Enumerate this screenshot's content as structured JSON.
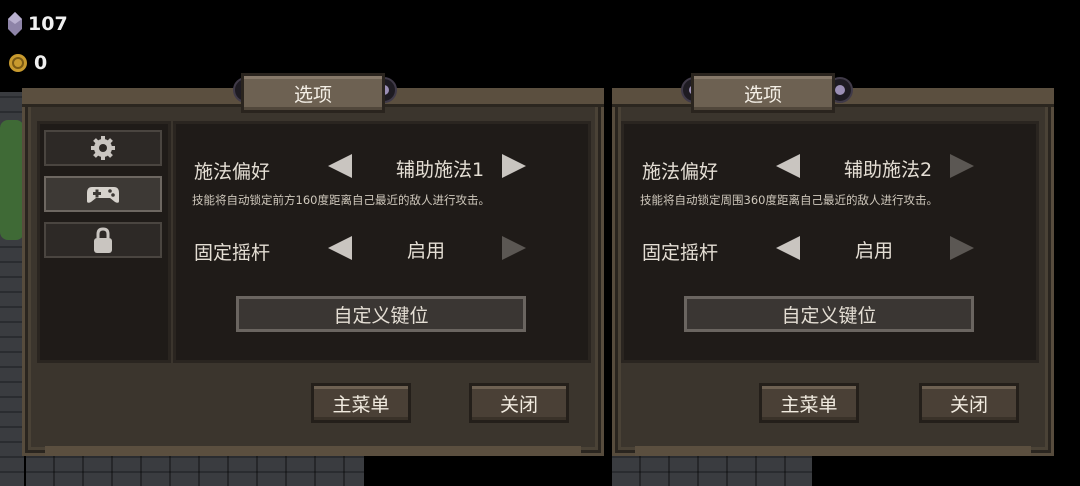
{
  "hud": {
    "gems": "107",
    "coins": "0"
  },
  "panels": [
    {
      "title": "选项",
      "option1": {
        "label": "施法偏好",
        "value": "辅助施法1",
        "desc": "技能将自动锁定前方160度距离自己最近的敌人进行攻击。"
      },
      "option2": {
        "label": "固定摇杆",
        "value": "启用"
      },
      "keybind": "自定义键位",
      "main_menu": "主菜单",
      "close": "关闭"
    },
    {
      "title": "选项",
      "option1": {
        "label": "施法偏好",
        "value": "辅助施法2",
        "desc": "技能将自动锁定周围360度距离自己最近的敌人进行攻击。"
      },
      "option2": {
        "label": "固定摇杆",
        "value": "启用"
      },
      "keybind": "自定义键位",
      "main_menu": "主菜单",
      "close": "关闭"
    }
  ],
  "icons": {
    "gem": "gem-icon",
    "coin": "coin-icon",
    "tab1": "gear-icon",
    "tab2": "gamepad-icon",
    "tab3": "lock-icon"
  },
  "colors": {
    "panel": "#3b352d",
    "content": "#1f1b18",
    "text": "#e4ded4"
  }
}
